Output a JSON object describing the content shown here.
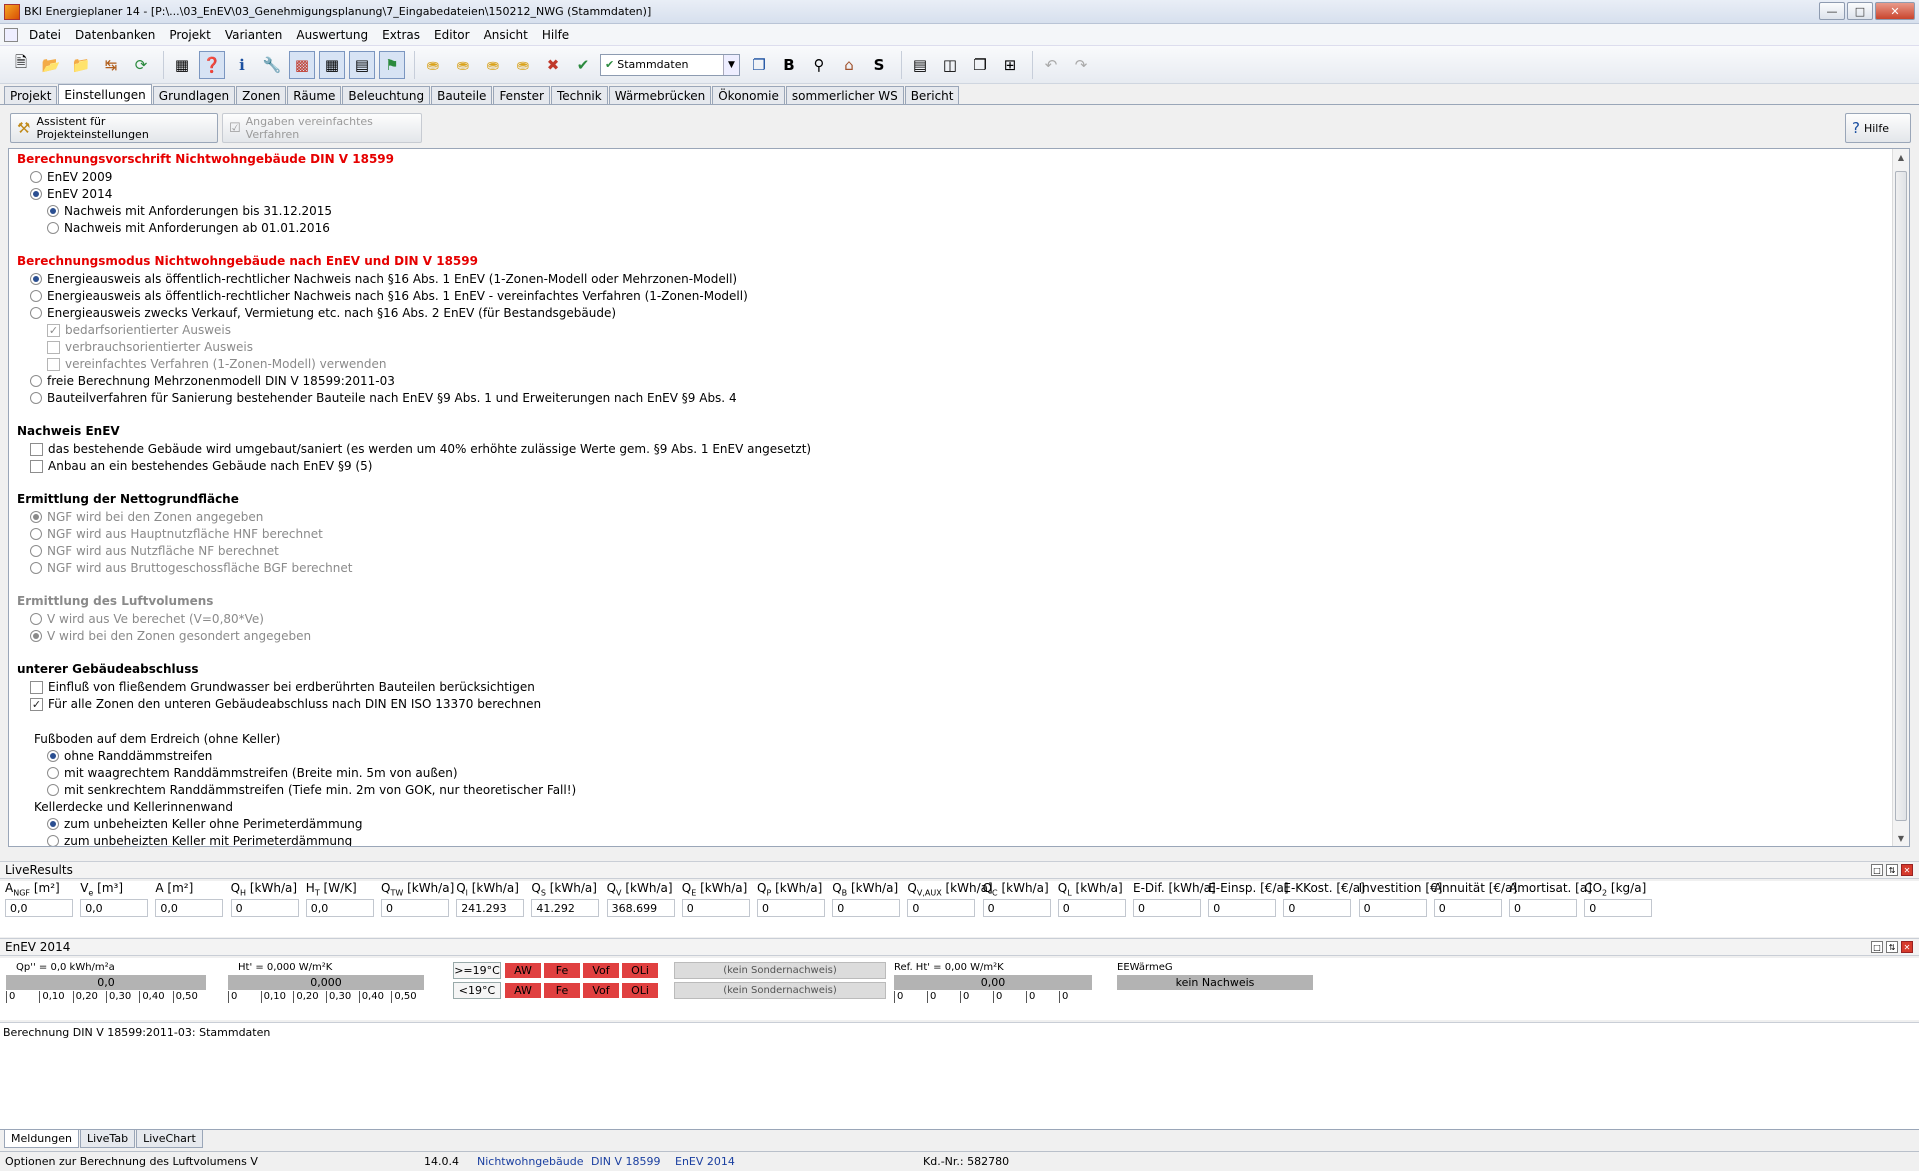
{
  "window": {
    "title": "BKI Energieplaner 14 - [P:\\...\\03_EnEV\\03_Genehmigungsplanung\\7_Eingabedateien\\150212_NWG (Stammdaten)]"
  },
  "menu": [
    "Datei",
    "Datenbanken",
    "Projekt",
    "Varianten",
    "Auswertung",
    "Extras",
    "Editor",
    "Ansicht",
    "Hilfe"
  ],
  "toolbar": {
    "variant_value": "Stammdaten"
  },
  "tabs": [
    "Projekt",
    "Einstellungen",
    "Grundlagen",
    "Zonen",
    "Räume",
    "Beleuchtung",
    "Bauteile",
    "Fenster",
    "Technik",
    "Wärmebrücken",
    "Ökonomie",
    "sommerlicher WS",
    "Bericht"
  ],
  "active_tab": "Einstellungen",
  "subbar": {
    "assistant_label": "Assistent für Projekteinstellungen",
    "simplified_label": "Angaben vereinfachtes Verfahren",
    "help_label": "Hilfe"
  },
  "settings": {
    "sec1": {
      "title": "Berechnungsvorschrift Nichtwohngebäude DIN V 18599",
      "opt1": "EnEV 2009",
      "opt2": "EnEV 2014",
      "sub1": "Nachweis mit Anforderungen bis 31.12.2015",
      "sub2": "Nachweis mit Anforderungen ab 01.01.2016"
    },
    "sec2": {
      "title": "Berechnungsmodus Nichtwohngebäude nach EnEV und DIN V 18599",
      "opt1": "Energieausweis als öffentlich-rechtlicher Nachweis nach §16 Abs. 1 EnEV (1-Zonen-Modell oder Mehrzonen-Modell)",
      "opt2": "Energieausweis als öffentlich-rechtlicher Nachweis nach §16 Abs. 1 EnEV - vereinfachtes Verfahren (1-Zonen-Modell)",
      "opt3": "Energieausweis zwecks Verkauf, Vermietung etc. nach §16 Abs. 2 EnEV (für Bestandsgebäude)",
      "chk1": "bedarfsorientierter Ausweis",
      "chk2": "verbrauchsorientierter Ausweis",
      "chk3": "vereinfachtes Verfahren (1-Zonen-Modell) verwenden",
      "opt4": "freie Berechnung Mehrzonenmodell DIN V 18599:2011-03",
      "opt5": "Bauteilverfahren für Sanierung bestehender Bauteile nach EnEV §9 Abs. 1 und Erweiterungen nach EnEV §9 Abs. 4"
    },
    "sec3": {
      "title": "Nachweis EnEV",
      "chk1": "das bestehende Gebäude wird umgebaut/saniert (es werden um 40% erhöhte zulässige Werte gem. §9 Abs. 1 EnEV angesetzt)",
      "chk2": "Anbau an ein bestehendes Gebäude nach EnEV §9 (5)"
    },
    "sec4": {
      "title": "Ermittlung der Nettogrundfläche",
      "opt1": "NGF wird bei den Zonen angegeben",
      "opt2": "NGF wird aus Hauptnutzfläche HNF berechnet",
      "opt3": "NGF wird aus Nutzfläche NF berechnet",
      "opt4": "NGF wird aus Bruttogeschossfläche BGF berechnet"
    },
    "sec5": {
      "title": "Ermittlung des Luftvolumens",
      "opt1": "V wird aus Ve berechet (V=0,80*Ve)",
      "opt2": "V wird bei den Zonen gesondert angegeben"
    },
    "sec6": {
      "title": "unterer Gebäudeabschluss",
      "chk1": "Einfluß von fließendem Grundwasser bei erdberührten Bauteilen berücksichtigen",
      "chk2": "Für alle Zonen den unteren Gebäudeabschluss nach DIN EN ISO 13370 berechnen",
      "floor_title": "Fußboden auf dem Erdreich (ohne Keller)",
      "floor1": "ohne Randdämmstreifen",
      "floor2": "mit waagrechtem Randdämmstreifen (Breite min. 5m von außen)",
      "floor3": "mit senkrechtem Randdämmstreifen (Tiefe min. 2m von GOK, nur theoretischer Fall!)",
      "cellar_title": "Kellerdecke und Kellerinnenwand",
      "cellar1": "zum unbeheizten Keller ohne Perimeterdämmung",
      "cellar2": "zum unbeheizten Keller mit Perimeterdämmung"
    }
  },
  "liveresults": {
    "title": "LiveResults",
    "cols": [
      {
        "label": "A",
        "sub": "NGF",
        "unit": " [m²]",
        "value": "0,0"
      },
      {
        "label": "V",
        "sub": "e",
        "unit": " [m³]",
        "value": "0,0"
      },
      {
        "label": "A",
        "sub": "",
        "unit": " [m²]",
        "value": "0,0"
      },
      {
        "label": "Q",
        "sub": "H",
        "unit": " [kWh/a]",
        "value": "0"
      },
      {
        "label": "H",
        "sub": "T",
        "unit": " [W/K]",
        "value": "0,0"
      },
      {
        "label": "Q",
        "sub": "TW",
        "unit": " [kWh/a]",
        "value": "0"
      },
      {
        "label": "Q",
        "sub": "l",
        "unit": " [kWh/a]",
        "value": "241.293"
      },
      {
        "label": "Q",
        "sub": "S",
        "unit": " [kWh/a]",
        "value": "41.292"
      },
      {
        "label": "Q",
        "sub": "V",
        "unit": " [kWh/a]",
        "value": "368.699"
      },
      {
        "label": "Q",
        "sub": "E",
        "unit": " [kWh/a]",
        "value": "0"
      },
      {
        "label": "Q",
        "sub": "P",
        "unit": " [kWh/a]",
        "value": "0"
      },
      {
        "label": "Q",
        "sub": "B",
        "unit": " [kWh/a]",
        "value": "0"
      },
      {
        "label": "Q",
        "sub": "V,AUX",
        "unit": " [kWh/a]",
        "value": "0"
      },
      {
        "label": "Q",
        "sub": "C",
        "unit": " [kWh/a]",
        "value": "0"
      },
      {
        "label": "Q",
        "sub": "L",
        "unit": " [kWh/a]",
        "value": "0"
      },
      {
        "label": "E-Dif.",
        "sub": "",
        "unit": " [kWh/a]",
        "value": "0"
      },
      {
        "label": "E-Einsp.",
        "sub": "",
        "unit": " [€/a]",
        "value": "0"
      },
      {
        "label": "E-KKost.",
        "sub": "",
        "unit": " [€/a]",
        "value": "0"
      },
      {
        "label": "Investition",
        "sub": "",
        "unit": " [€]",
        "value": "0"
      },
      {
        "label": "Annuität",
        "sub": "",
        "unit": " [€/a]",
        "value": "0"
      },
      {
        "label": "Amortisat.",
        "sub": "",
        "unit": " [a]",
        "value": "0"
      },
      {
        "label": "CO",
        "sub": "2",
        "unit": " [kg/a]",
        "value": "0"
      }
    ]
  },
  "enev": {
    "title": "EnEV 2014",
    "qp_label": "Qp'' = 0,0 kWh/m²a",
    "qp_value": "0,0",
    "ht_label": "Ht' = 0,000 W/m²K",
    "ht_value": "0,000",
    "ticks": [
      "0",
      "0,10",
      "0,20",
      "0,30",
      "0,40",
      "0,50"
    ],
    "temp1": ">=19°C",
    "temp2": "<19°C",
    "elements": [
      "AW",
      "Fe",
      "Vof",
      "OLi"
    ],
    "sonder1": "(kein Sondernachweis)",
    "sonder2": "(kein Sondernachweis)",
    "ref_label": "Ref. Ht' = 0,00 W/m²K",
    "ref_value": "0,00",
    "ref_ticks": [
      "0",
      "0",
      "0",
      "0",
      "0",
      "0"
    ],
    "eew_label": "EEWärmeG",
    "eew_value": "kein Nachweis"
  },
  "messages": {
    "text": "Berechnung DIN V 18599:2011-03: Stammdaten"
  },
  "bottom_tabs": [
    "Meldungen",
    "LiveTab",
    "LiveChart"
  ],
  "status": {
    "hint": "Optionen zur Berechnung des Luftvolumens V",
    "version": "14.0.4",
    "type": "Nichtwohngebäude",
    "norm": "DIN V 18599",
    "enev": "EnEV 2014",
    "customer": "Kd.-Nr.: 582780"
  }
}
